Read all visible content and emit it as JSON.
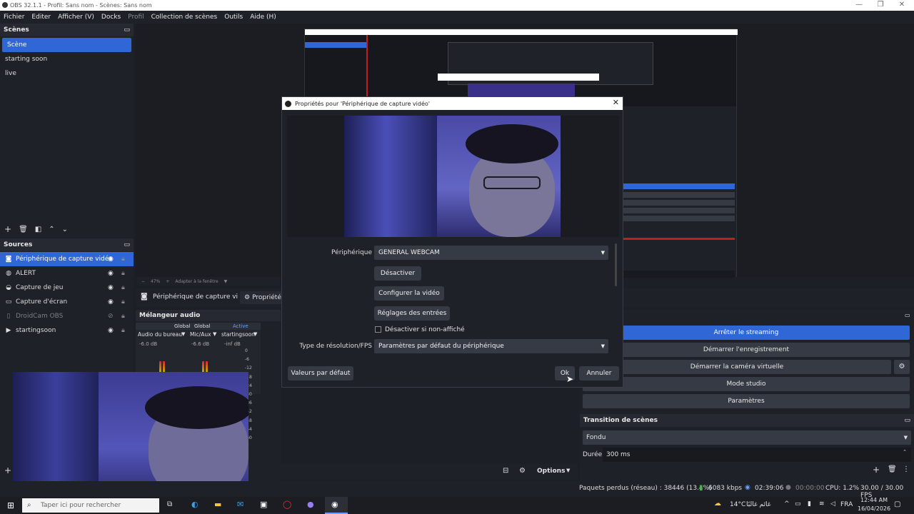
{
  "window": {
    "title": "OBS 32.1.1 - Profil: Sans nom - Scènes: Sans nom",
    "minimize": "—",
    "maximize": "❐",
    "close": "✕"
  },
  "menu": [
    "Fichier",
    "Editer",
    "Afficher (V)",
    "Docks",
    "Profil",
    "Collection de scènes",
    "Outils",
    "Aide (H)"
  ],
  "scenes": {
    "title": "Scènes",
    "items": [
      "Scène",
      "starting soon",
      "live"
    ]
  },
  "sources": {
    "title": "Sources",
    "items": [
      {
        "name": "Périphérique de capture vidéo",
        "icon": "camera-icon"
      },
      {
        "name": "ALERT",
        "icon": "globe-icon"
      },
      {
        "name": "Capture de jeu",
        "icon": "gamepad-icon"
      },
      {
        "name": "Capture d'écran",
        "icon": "monitor-icon"
      },
      {
        "name": "DroidCam OBS",
        "icon": "phone-icon"
      },
      {
        "name": "startingsoon",
        "icon": "play-icon"
      }
    ]
  },
  "preview_toolbar": {
    "zoom": "47%",
    "fit": "Adapter à la fenêtre"
  },
  "source_toolbar": {
    "source_name": "Périphérique de capture vi",
    "properties_label": "Propriétés"
  },
  "mixer": {
    "title": "Mélangeur audio",
    "channels": [
      {
        "scope": "Global",
        "name": "Audio du bureau",
        "level": "-6.0 dB"
      },
      {
        "scope": "Global",
        "name": "Mic/Aux",
        "level": "-6.6 dB"
      },
      {
        "scope": "Active",
        "name": "startingsoon",
        "level": "-inf dB"
      }
    ],
    "scale": [
      "0",
      "-6",
      "-12",
      "-18",
      "-24",
      "-30",
      "-36",
      "-42",
      "-48",
      "-54",
      "-60"
    ]
  },
  "controls": {
    "stop_streaming": "Arrêter le streaming",
    "start_recording": "Démarrer l'enregistrement",
    "virtual_cam": "Démarrer la caméra virtuelle",
    "studio_mode": "Mode studio",
    "settings": "Paramètres"
  },
  "transitions": {
    "title": "Transition de scènes",
    "type": "Fondu",
    "duration_label": "Durée",
    "duration": "300 ms"
  },
  "bottom_bar": {
    "options": "Options"
  },
  "dialog": {
    "title": "Propriétés pour 'Périphérique de capture vidéo'",
    "device_label": "Périphérique",
    "device_value": "GENERAL WEBCAM",
    "deactivate": "Désactiver",
    "configure_video": "Configurer la vidéo",
    "input_settings": "Réglages des entrées",
    "hide_checkbox": "Désactiver si non-affiché",
    "res_label": "Type de résolution/FPS",
    "res_value": "Paramètres par défaut du périphérique",
    "defaults": "Valeurs par défaut",
    "ok": "Ok",
    "cancel": "Annuler"
  },
  "status": {
    "dropped": "Paquets perdus (réseau) : 38446 (13.4%)",
    "bitrate": "6083 kbps",
    "stream_time": "02:39:06",
    "rec_time": "00:00:00",
    "cpu": "CPU: 1.2%",
    "fps": "30.00 / 30.00 FPS"
  },
  "taskbar": {
    "search_placeholder": "Taper ici pour rechercher",
    "weather_temp": "14°C",
    "weather_text": "غائم غالبًا",
    "lang": "FRA",
    "time": "12:44 AM",
    "date": "16/04/2026"
  },
  "colors": {
    "accent": "#2f68d6",
    "panel": "#1f2128",
    "button": "#363a45",
    "bg": "#1d1f26",
    "webcam": "#2a2a7a"
  }
}
